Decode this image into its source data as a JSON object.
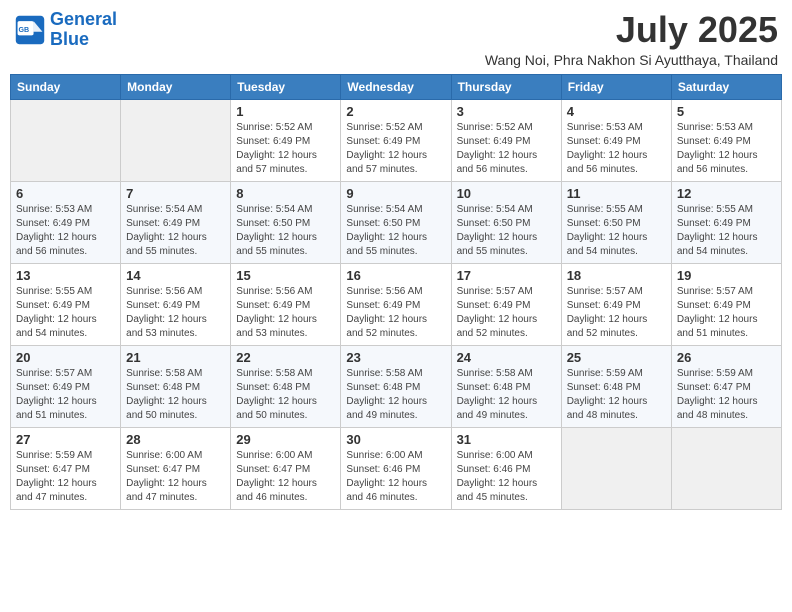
{
  "header": {
    "logo_line1": "General",
    "logo_line2": "Blue",
    "month": "July 2025",
    "location": "Wang Noi, Phra Nakhon Si Ayutthaya, Thailand"
  },
  "days_of_week": [
    "Sunday",
    "Monday",
    "Tuesday",
    "Wednesday",
    "Thursday",
    "Friday",
    "Saturday"
  ],
  "weeks": [
    [
      {
        "day": "",
        "info": ""
      },
      {
        "day": "",
        "info": ""
      },
      {
        "day": "1",
        "info": "Sunrise: 5:52 AM\nSunset: 6:49 PM\nDaylight: 12 hours and 57 minutes."
      },
      {
        "day": "2",
        "info": "Sunrise: 5:52 AM\nSunset: 6:49 PM\nDaylight: 12 hours and 57 minutes."
      },
      {
        "day": "3",
        "info": "Sunrise: 5:52 AM\nSunset: 6:49 PM\nDaylight: 12 hours and 56 minutes."
      },
      {
        "day": "4",
        "info": "Sunrise: 5:53 AM\nSunset: 6:49 PM\nDaylight: 12 hours and 56 minutes."
      },
      {
        "day": "5",
        "info": "Sunrise: 5:53 AM\nSunset: 6:49 PM\nDaylight: 12 hours and 56 minutes."
      }
    ],
    [
      {
        "day": "6",
        "info": "Sunrise: 5:53 AM\nSunset: 6:49 PM\nDaylight: 12 hours and 56 minutes."
      },
      {
        "day": "7",
        "info": "Sunrise: 5:54 AM\nSunset: 6:49 PM\nDaylight: 12 hours and 55 minutes."
      },
      {
        "day": "8",
        "info": "Sunrise: 5:54 AM\nSunset: 6:50 PM\nDaylight: 12 hours and 55 minutes."
      },
      {
        "day": "9",
        "info": "Sunrise: 5:54 AM\nSunset: 6:50 PM\nDaylight: 12 hours and 55 minutes."
      },
      {
        "day": "10",
        "info": "Sunrise: 5:54 AM\nSunset: 6:50 PM\nDaylight: 12 hours and 55 minutes."
      },
      {
        "day": "11",
        "info": "Sunrise: 5:55 AM\nSunset: 6:50 PM\nDaylight: 12 hours and 54 minutes."
      },
      {
        "day": "12",
        "info": "Sunrise: 5:55 AM\nSunset: 6:49 PM\nDaylight: 12 hours and 54 minutes."
      }
    ],
    [
      {
        "day": "13",
        "info": "Sunrise: 5:55 AM\nSunset: 6:49 PM\nDaylight: 12 hours and 54 minutes."
      },
      {
        "day": "14",
        "info": "Sunrise: 5:56 AM\nSunset: 6:49 PM\nDaylight: 12 hours and 53 minutes."
      },
      {
        "day": "15",
        "info": "Sunrise: 5:56 AM\nSunset: 6:49 PM\nDaylight: 12 hours and 53 minutes."
      },
      {
        "day": "16",
        "info": "Sunrise: 5:56 AM\nSunset: 6:49 PM\nDaylight: 12 hours and 52 minutes."
      },
      {
        "day": "17",
        "info": "Sunrise: 5:57 AM\nSunset: 6:49 PM\nDaylight: 12 hours and 52 minutes."
      },
      {
        "day": "18",
        "info": "Sunrise: 5:57 AM\nSunset: 6:49 PM\nDaylight: 12 hours and 52 minutes."
      },
      {
        "day": "19",
        "info": "Sunrise: 5:57 AM\nSunset: 6:49 PM\nDaylight: 12 hours and 51 minutes."
      }
    ],
    [
      {
        "day": "20",
        "info": "Sunrise: 5:57 AM\nSunset: 6:49 PM\nDaylight: 12 hours and 51 minutes."
      },
      {
        "day": "21",
        "info": "Sunrise: 5:58 AM\nSunset: 6:48 PM\nDaylight: 12 hours and 50 minutes."
      },
      {
        "day": "22",
        "info": "Sunrise: 5:58 AM\nSunset: 6:48 PM\nDaylight: 12 hours and 50 minutes."
      },
      {
        "day": "23",
        "info": "Sunrise: 5:58 AM\nSunset: 6:48 PM\nDaylight: 12 hours and 49 minutes."
      },
      {
        "day": "24",
        "info": "Sunrise: 5:58 AM\nSunset: 6:48 PM\nDaylight: 12 hours and 49 minutes."
      },
      {
        "day": "25",
        "info": "Sunrise: 5:59 AM\nSunset: 6:48 PM\nDaylight: 12 hours and 48 minutes."
      },
      {
        "day": "26",
        "info": "Sunrise: 5:59 AM\nSunset: 6:47 PM\nDaylight: 12 hours and 48 minutes."
      }
    ],
    [
      {
        "day": "27",
        "info": "Sunrise: 5:59 AM\nSunset: 6:47 PM\nDaylight: 12 hours and 47 minutes."
      },
      {
        "day": "28",
        "info": "Sunrise: 6:00 AM\nSunset: 6:47 PM\nDaylight: 12 hours and 47 minutes."
      },
      {
        "day": "29",
        "info": "Sunrise: 6:00 AM\nSunset: 6:47 PM\nDaylight: 12 hours and 46 minutes."
      },
      {
        "day": "30",
        "info": "Sunrise: 6:00 AM\nSunset: 6:46 PM\nDaylight: 12 hours and 46 minutes."
      },
      {
        "day": "31",
        "info": "Sunrise: 6:00 AM\nSunset: 6:46 PM\nDaylight: 12 hours and 45 minutes."
      },
      {
        "day": "",
        "info": ""
      },
      {
        "day": "",
        "info": ""
      }
    ]
  ]
}
